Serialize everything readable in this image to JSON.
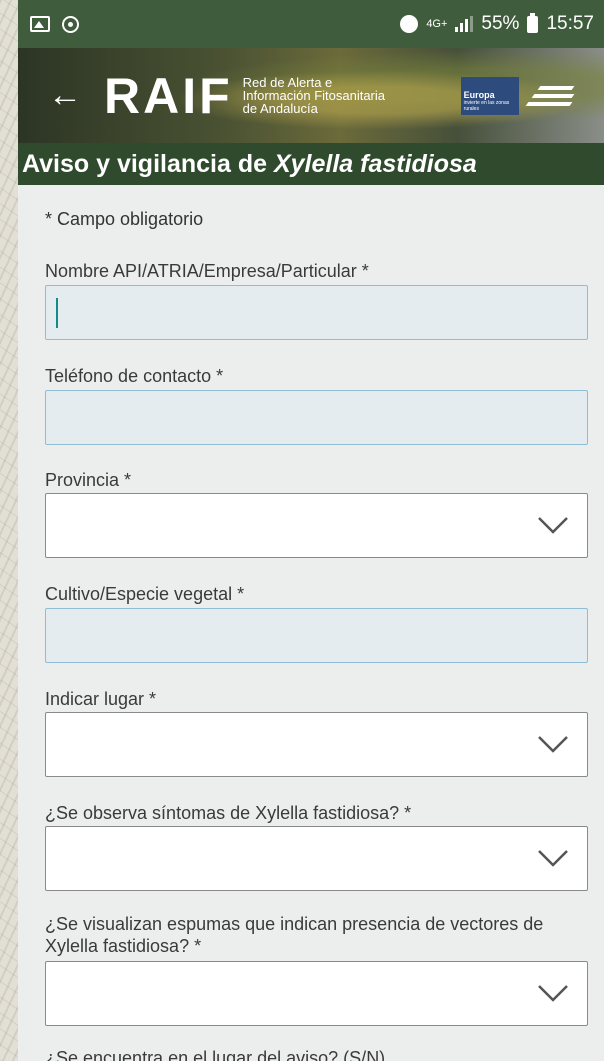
{
  "status_bar": {
    "network": "4G+",
    "battery": "55%",
    "time": "15:57",
    "icons": [
      "gallery-icon",
      "sync-icon",
      "alarm-icon",
      "signal-icon",
      "battery-icon"
    ]
  },
  "header": {
    "logo": "RAIF",
    "subtitle_line1": "Red de Alerta e",
    "subtitle_line2": "Información Fitosanitaria",
    "subtitle_line3": "de Andalucía",
    "eu_label": "Europa",
    "eu_tagline": "invierte en las zonas rurales"
  },
  "title": {
    "prefix": "Aviso y vigilancia de ",
    "italic": "Xylella fastidiosa"
  },
  "form": {
    "required_note": "* Campo obligatorio",
    "fields": [
      {
        "label": "Nombre API/ATRIA/Empresa/Particular *",
        "type": "text",
        "value": ""
      },
      {
        "label": "Teléfono de contacto *",
        "type": "text",
        "value": ""
      },
      {
        "label": "Provincia *",
        "type": "select",
        "value": ""
      },
      {
        "label": "Cultivo/Especie vegetal *",
        "type": "text",
        "value": ""
      },
      {
        "label": "Indicar lugar *",
        "type": "select",
        "value": ""
      },
      {
        "label": "¿Se observa síntomas de Xylella fastidiosa? *",
        "type": "select",
        "value": ""
      },
      {
        "label": "¿Se visualizan espumas que indican presencia de vectores de Xylella fastidiosa? *",
        "type": "select",
        "value": ""
      },
      {
        "label": "¿Se encuentra en el lugar del aviso? (S/N)",
        "type": "select",
        "value": ""
      }
    ]
  },
  "colors": {
    "status_bar": "#3f5c3c",
    "title_bar": "#2f4a2d",
    "input_border": "#8fbdd3",
    "cursor": "#138b8a"
  }
}
